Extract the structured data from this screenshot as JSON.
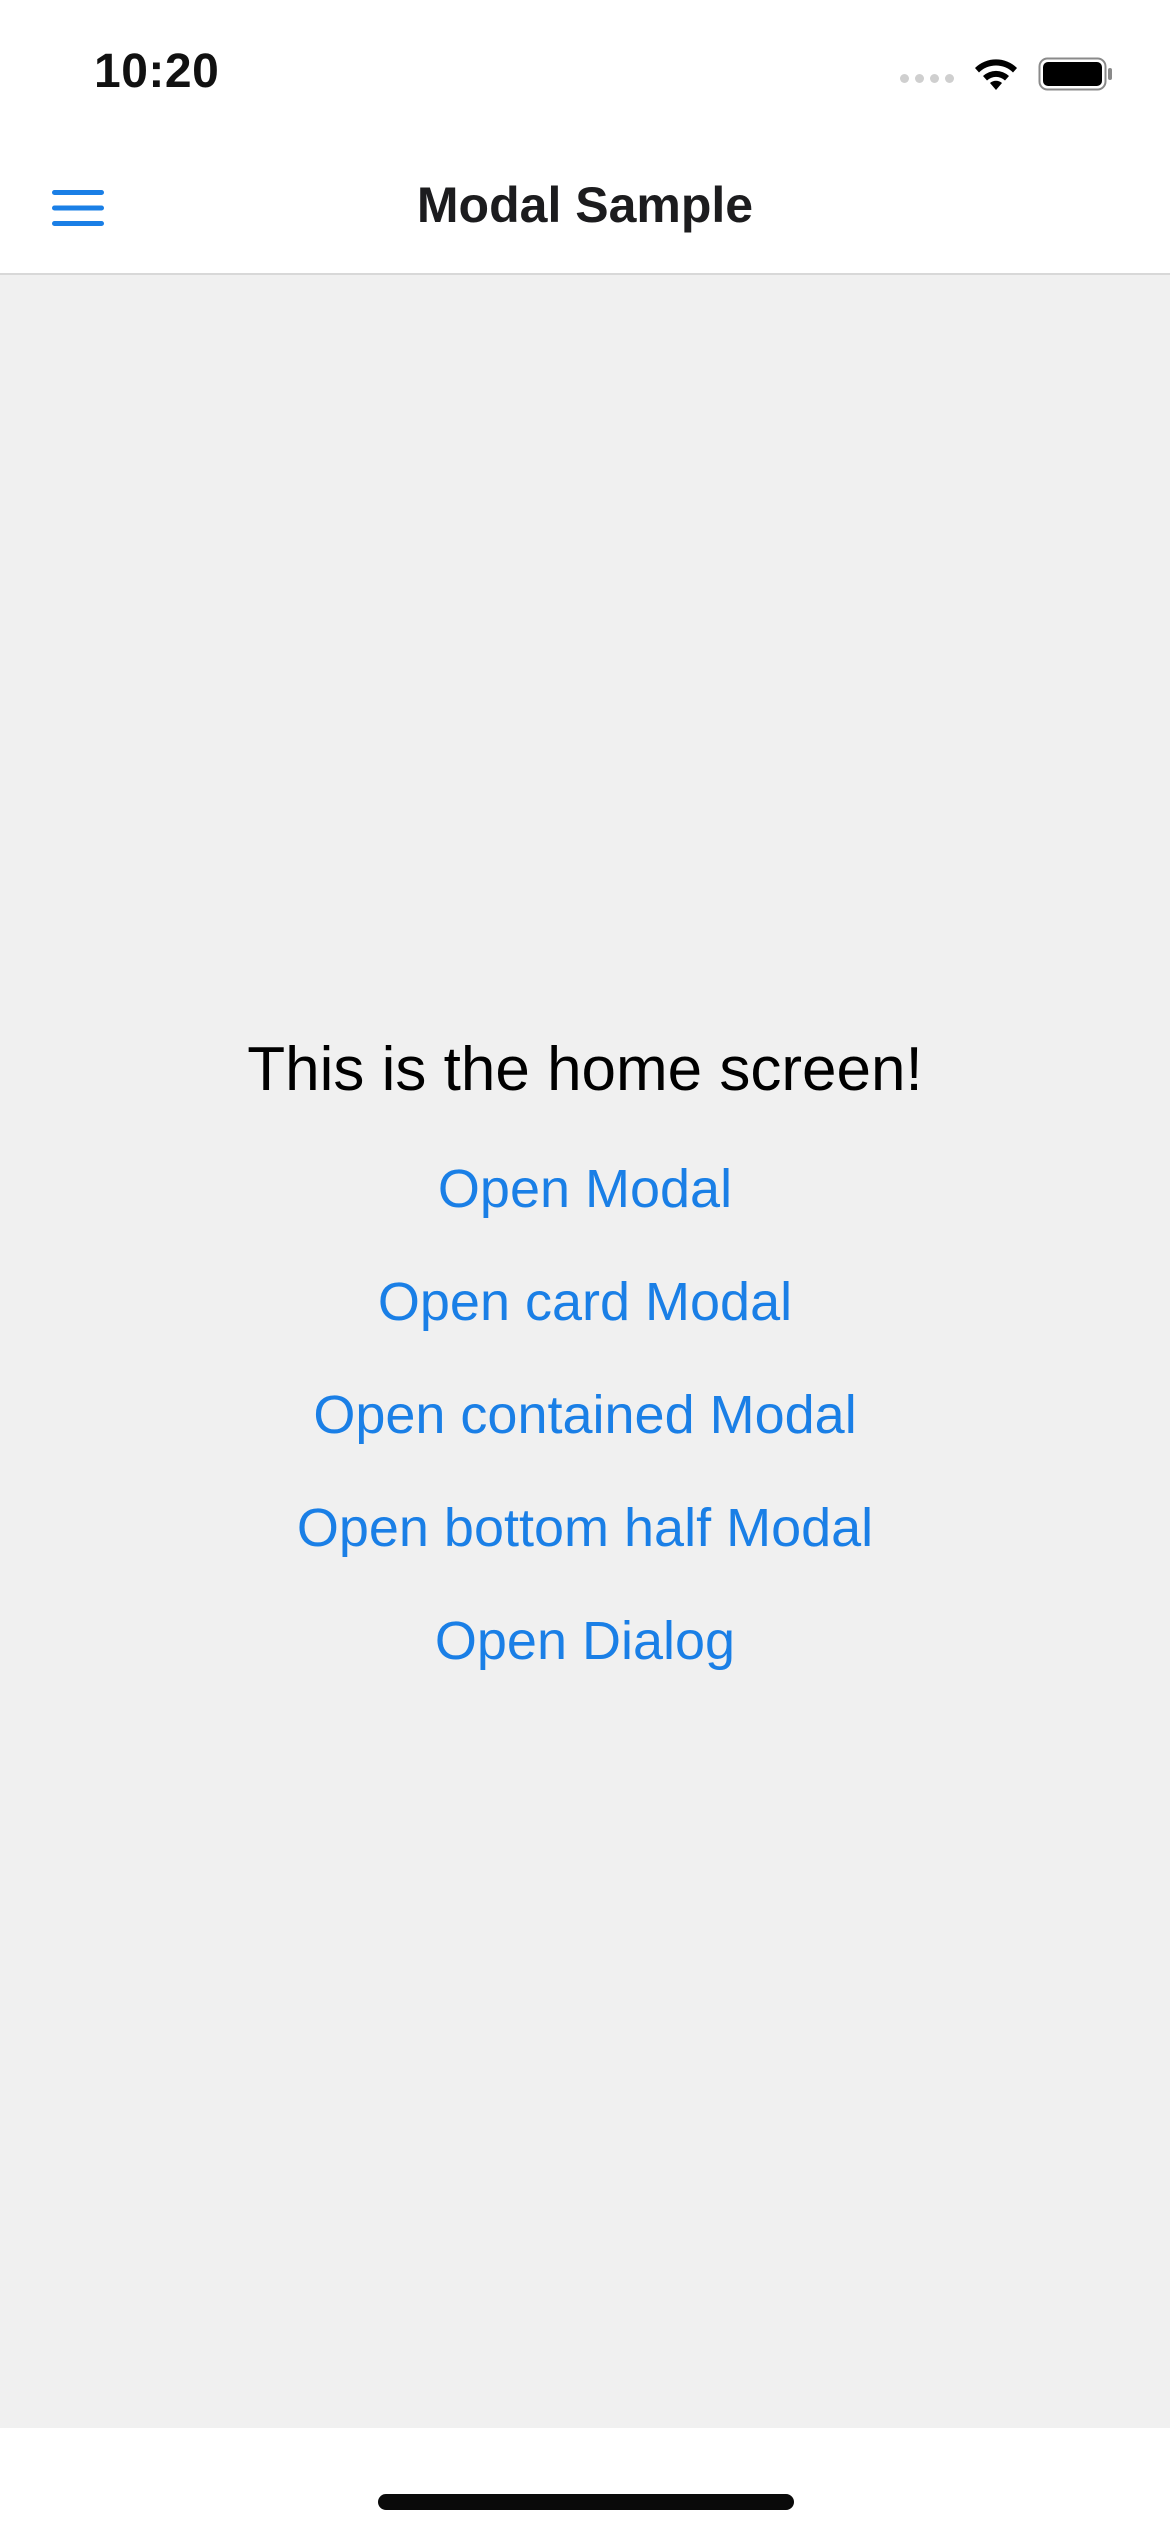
{
  "status_bar": {
    "time": "10:20"
  },
  "header": {
    "title": "Modal Sample",
    "menu_icon": "hamburger-menu-icon",
    "accent_color": "#1a7fe6"
  },
  "main": {
    "heading": "This is the home screen!",
    "buttons": [
      {
        "label": "Open Modal"
      },
      {
        "label": "Open card Modal"
      },
      {
        "label": "Open contained Modal"
      },
      {
        "label": "Open bottom half Modal"
      },
      {
        "label": "Open Dialog"
      }
    ]
  },
  "colors": {
    "link": "#1a7fe6",
    "background": "#f0f0f0",
    "header_background": "#ffffff"
  }
}
